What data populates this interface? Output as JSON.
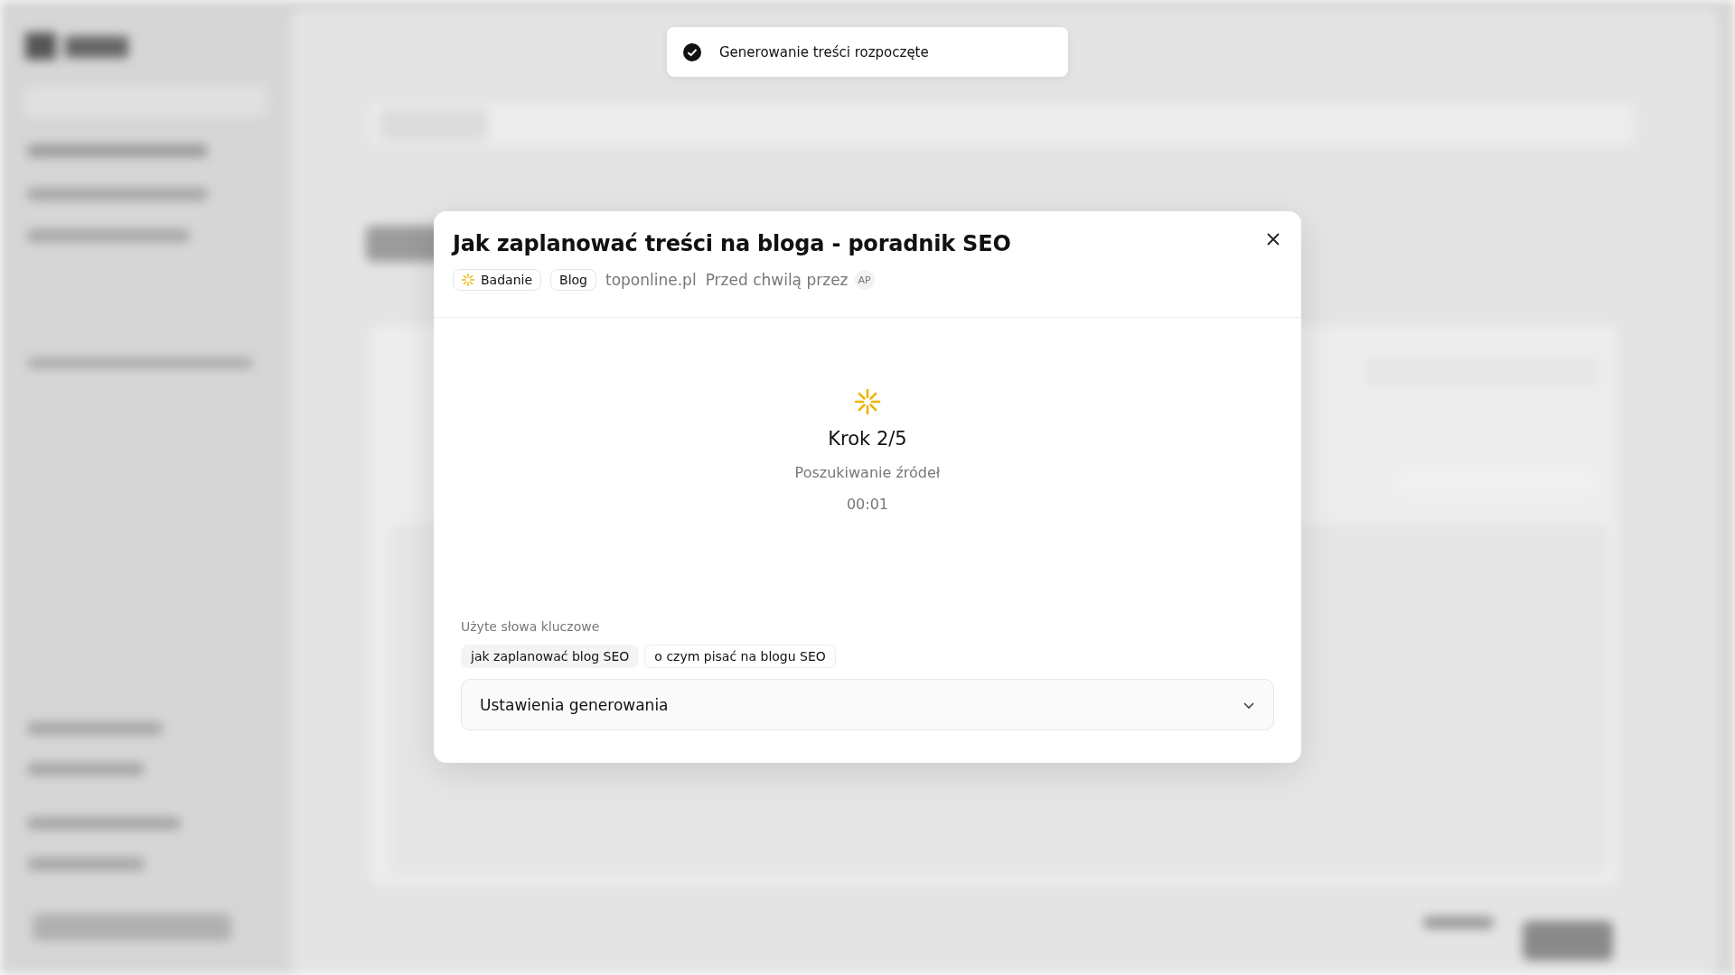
{
  "toast": {
    "message": "Generowanie treści rozpoczęte",
    "kind": "success"
  },
  "modal": {
    "title": "Jak zaplanować treści na bloga - poradnik SEO",
    "tags": [
      {
        "label": "Badanie",
        "kind": "status"
      },
      {
        "label": "Blog",
        "kind": "plain"
      }
    ],
    "site": "toponline.pl",
    "time_text": "Przed chwilą przez",
    "author_initials": "AP",
    "progress": {
      "step": "Krok 2/5",
      "stage": "Poszukiwanie źródeł",
      "timer": "00:01"
    },
    "keywords_label": "Użyte słowa kluczowe",
    "keywords": [
      "jak zaplanować blog SEO",
      "o czym pisać na blogu SEO"
    ],
    "settings": {
      "label": "Ustawienia generowania",
      "expanded": false
    }
  }
}
